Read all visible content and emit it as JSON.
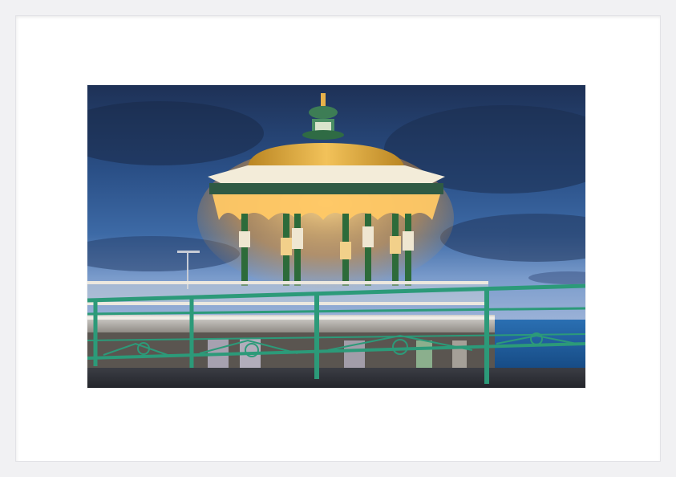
{
  "colors": {
    "frame": "#f1f1f3",
    "mat": "#ffffff",
    "sky_top": "#243a63",
    "sky_mid": "#2f5a92",
    "sky_low": "#6f92c4",
    "sea": "#1d5fa2",
    "railing_green": "#2e9a7a",
    "bandstand_green": "#2f6b3a",
    "dome_gold": "#d9a53a",
    "canopy_glow": "#f0b551",
    "lamp_white": "#f4ede0"
  },
  "icons": {
    "photo": "bandstand-photo-image"
  }
}
